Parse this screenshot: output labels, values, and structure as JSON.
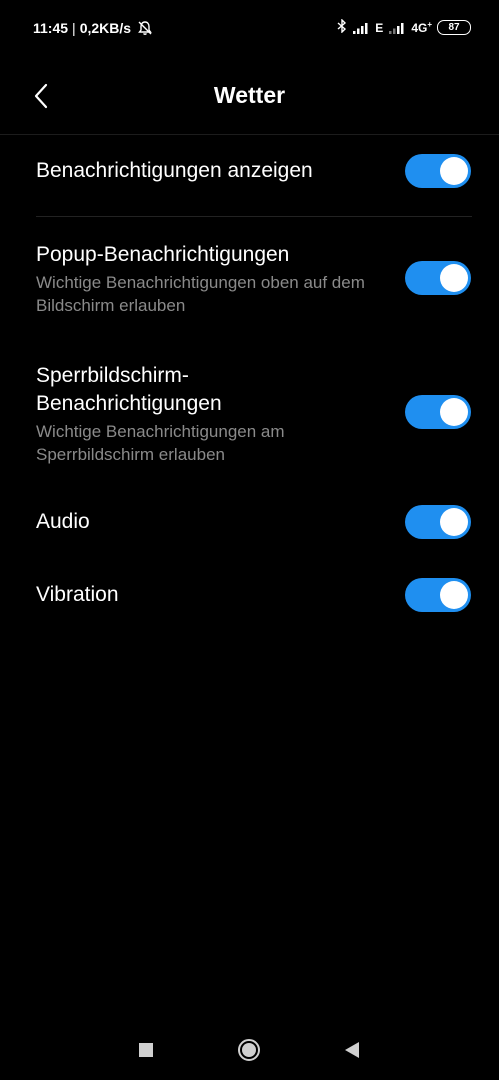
{
  "status_bar": {
    "time": "11:45",
    "separator": "|",
    "network_speed": "0,2KB/s",
    "icons": [
      "mute-icon",
      "bluetooth-icon",
      "signal-icon",
      "signal-icon",
      "battery-icon"
    ],
    "sim1_network": "E",
    "sim2_network": "4G",
    "sim2_network_plus": "+",
    "battery_level": "87"
  },
  "header": {
    "back_icon": "chevron-left-icon",
    "title": "Wetter"
  },
  "settings": {
    "items": [
      {
        "title": "Benachrichtigungen anzeigen",
        "subtitle": "",
        "enabled": true
      },
      {
        "title": "Popup-Benachrichtigungen",
        "subtitle": "Wichtige Benachrichtigungen oben auf dem Bildschirm erlauben",
        "enabled": true
      },
      {
        "title": "Sperrbildschirm-Benachrichtigungen",
        "title_line1": "Sperrbildschirm-",
        "title_line2": "Benachrichtigungen",
        "subtitle": "Wichtige Benachrichtigungen am Sperrbildschirm erlauben",
        "enabled": true
      },
      {
        "title": "Audio",
        "subtitle": "",
        "enabled": true
      },
      {
        "title": "Vibration",
        "subtitle": "",
        "enabled": true
      }
    ]
  },
  "colors": {
    "background": "#000000",
    "toggle_on": "#1f8ff0",
    "subtitle": "#8a8a8a"
  },
  "nav_bar": {
    "icons": [
      "recents-square-icon",
      "home-circle-icon",
      "back-triangle-icon"
    ]
  }
}
